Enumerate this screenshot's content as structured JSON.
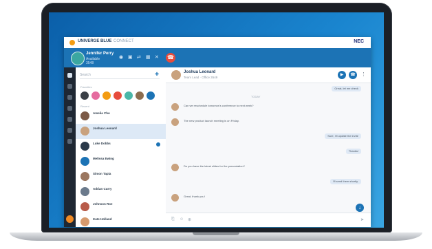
{
  "app": {
    "brand": "UNIVERGE BLUE",
    "brand_sub": "CONNECT",
    "vendor": "NEC"
  },
  "me": {
    "name": "Jennifer Perry",
    "status": "Available",
    "ext": "3548"
  },
  "header_icons": [
    "speaker-icon",
    "video-icon",
    "transfer-icon",
    "keypad-icon",
    "mute-icon"
  ],
  "contacts": {
    "search_placeholder": "Search",
    "favorites_label": "Favorites",
    "recent_label": "Recent",
    "favorites_colors": [
      "#3a3f46",
      "#e56b9f",
      "#f39c12",
      "#e74c3c",
      "#4bb7a8",
      "#8c6d4f",
      "#1c73b5"
    ],
    "items": [
      {
        "name": "Amelia Cho",
        "preview": "",
        "color": "#7c5a47",
        "badge": false,
        "selected": false
      },
      {
        "name": "Joshua Leonard",
        "preview": "",
        "color": "#c9a27e",
        "badge": false,
        "selected": true
      },
      {
        "name": "Luke Dobbs",
        "preview": "",
        "color": "#2b3a4a",
        "badge": true,
        "selected": false
      },
      {
        "name": "Melissa Ewing",
        "preview": "",
        "color": "#1c73b5",
        "badge": false,
        "selected": false
      },
      {
        "name": "Simon Tapia",
        "preview": "",
        "color": "#9b7760",
        "badge": false,
        "selected": false
      },
      {
        "name": "Adrian Curry",
        "preview": "",
        "color": "#6b7a8c",
        "badge": false,
        "selected": false
      },
      {
        "name": "Johnson Roe",
        "preview": "",
        "color": "#b85c4a",
        "badge": false,
        "selected": false
      },
      {
        "name": "Kate Holland",
        "preview": "",
        "color": "#d69a6e",
        "badge": false,
        "selected": false
      }
    ]
  },
  "chat": {
    "name": "Joshua Leonard",
    "status": "Team Lead · Office 3549",
    "today_label": "TODAY",
    "messages": [
      {
        "dir": "out",
        "text": "Great, let me check",
        "meta": ""
      },
      {
        "dir": "in",
        "text": "Can we reschedule tomorrow's conference to next week?",
        "meta": ""
      },
      {
        "dir": "in",
        "text": "The new product launch meeting is on Friday.",
        "meta": ""
      },
      {
        "dir": "out",
        "text": "Sure, I'll update the invite",
        "meta": ""
      },
      {
        "dir": "out",
        "text": "Thanks!",
        "meta": ""
      },
      {
        "dir": "in",
        "text": "Do you have the latest slides for the presentation?",
        "meta": ""
      },
      {
        "dir": "out",
        "text": "I'll send them shortly.",
        "meta": ""
      },
      {
        "dir": "in",
        "text": "Great, thank you!",
        "meta": ""
      }
    ],
    "compose_icons": [
      "attach-icon",
      "emoji-icon",
      "more-icon"
    ]
  }
}
